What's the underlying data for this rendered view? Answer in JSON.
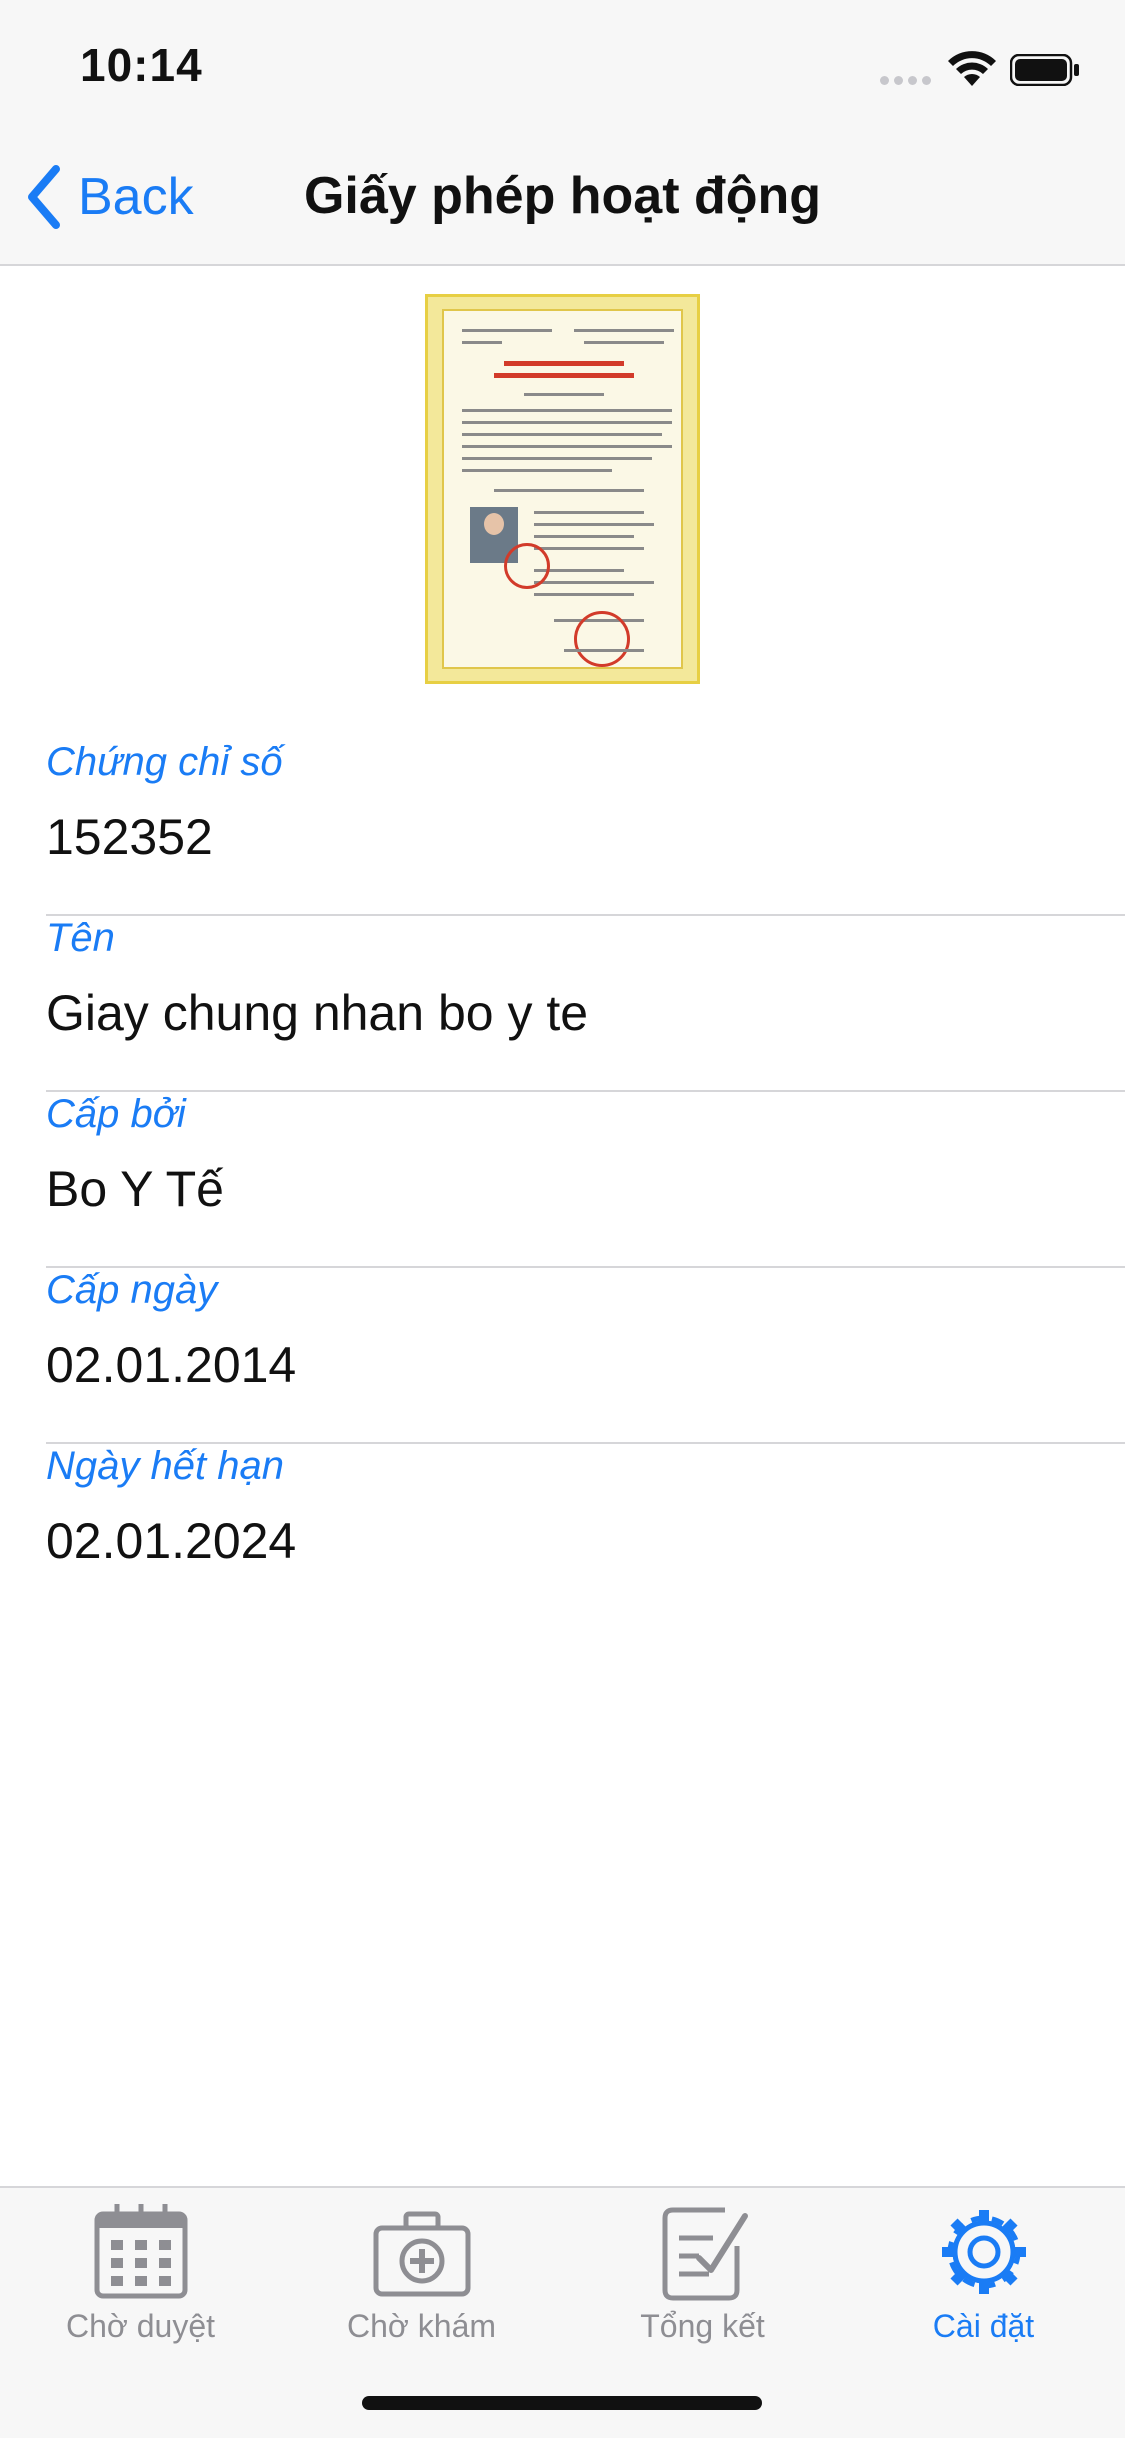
{
  "status_bar": {
    "time": "10:14"
  },
  "nav": {
    "back_label": "Back",
    "title": "Giấy phép hoạt động"
  },
  "fields": [
    {
      "label": "Chứng chỉ số",
      "value": "152352"
    },
    {
      "label": "Tên",
      "value": "Giay chung nhan bo y te"
    },
    {
      "label": "Cấp bởi",
      "value": "Bo Y Tế"
    },
    {
      "label": "Cấp ngày",
      "value": "02.01.2014"
    },
    {
      "label": "Ngày hết hạn",
      "value": "02.01.2024"
    }
  ],
  "tabs": [
    {
      "label": "Chờ duyệt",
      "icon": "calendar-icon",
      "active": false
    },
    {
      "label": "Chờ khám",
      "icon": "medical-kit-icon",
      "active": false
    },
    {
      "label": "Tổng kết",
      "icon": "checklist-icon",
      "active": false
    },
    {
      "label": "Cài đặt",
      "icon": "gear-icon",
      "active": true
    }
  ],
  "colors": {
    "accent": "#1a7cf5",
    "inactive": "#8e8e93",
    "bar_bg": "#f7f7f7"
  }
}
